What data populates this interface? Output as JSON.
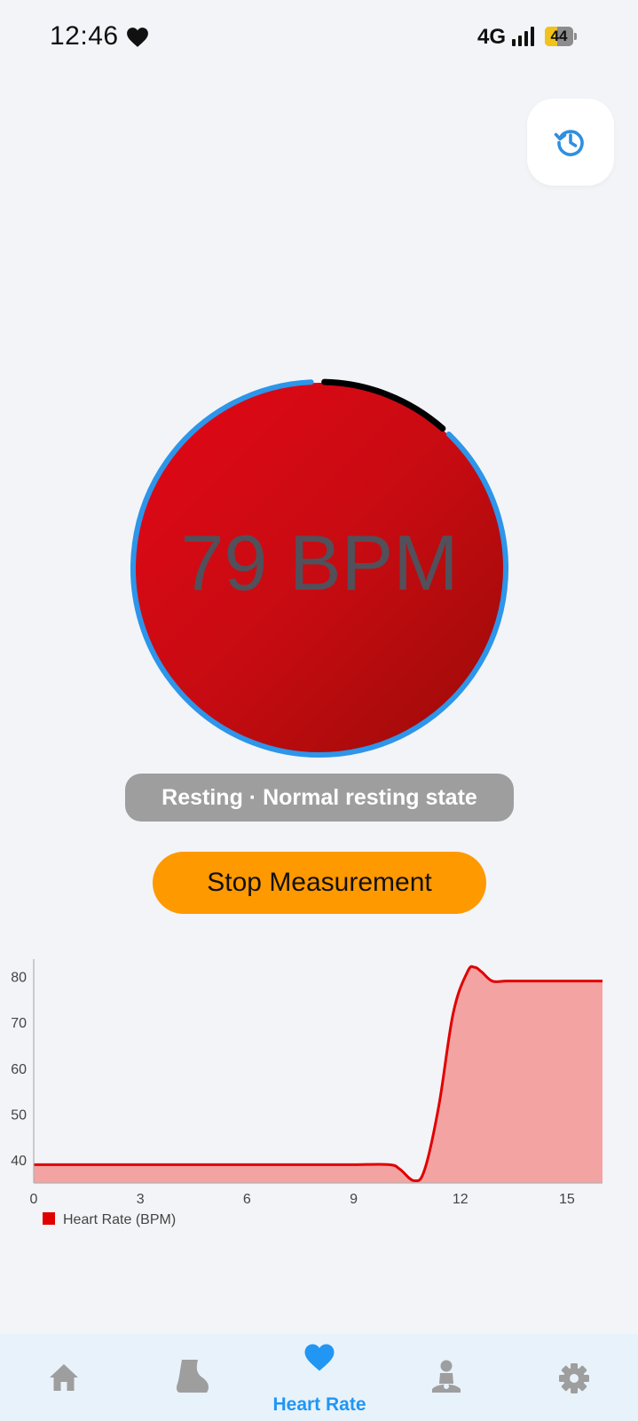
{
  "status_bar": {
    "time": "12:46",
    "network": "4G",
    "battery_level": "44",
    "battery_fraction": 0.44,
    "icons": [
      "heart-icon",
      "signal-icon",
      "battery-icon"
    ]
  },
  "history_button": {
    "icon": "history-icon",
    "color": "#2f8fe0"
  },
  "gauge": {
    "value_text": "79 BPM",
    "progress_fraction": 0.115,
    "colors": {
      "track": "#2d95ea",
      "progress": "#000000",
      "fill_start": "#e20716",
      "fill_end": "#9b0b07"
    }
  },
  "state": {
    "label": "Resting · Normal resting state"
  },
  "controls": {
    "stop_label": "Stop Measurement",
    "stop_color": "#ff9900"
  },
  "chart_data": {
    "type": "area",
    "x": [
      0,
      1,
      2,
      3,
      4,
      5,
      6,
      7,
      8,
      9,
      10,
      10.3,
      10.7,
      11,
      11.4,
      11.8,
      12.2,
      12.4,
      12.6,
      12.9,
      13.3,
      14,
      15,
      16
    ],
    "series": [
      {
        "name": "Heart Rate (BPM)",
        "values": [
          39,
          39,
          39,
          39,
          39,
          39,
          39,
          39,
          39,
          39,
          39,
          38,
          35.5,
          38,
          52,
          72,
          81,
          82,
          81,
          79,
          79,
          79,
          79,
          79
        ]
      }
    ],
    "x_ticks": [
      0,
      3,
      6,
      9,
      12,
      15
    ],
    "y_ticks": [
      40,
      50,
      60,
      70,
      80
    ],
    "xlim": [
      0,
      16
    ],
    "ylim": [
      35,
      83
    ],
    "grid": false,
    "legend_position": "bottom-left",
    "colors": {
      "line": "#e00000",
      "fill": "#f4a3a3",
      "legend_marker": "#e00000"
    }
  },
  "bottom_nav": {
    "items": [
      {
        "id": "home",
        "icon": "home-icon",
        "label": "",
        "active": false
      },
      {
        "id": "steps",
        "icon": "foot-icon",
        "label": "",
        "active": false
      },
      {
        "id": "heart-rate",
        "icon": "heart-icon",
        "label": "Heart Rate",
        "active": true
      },
      {
        "id": "meditation",
        "icon": "meditation-icon",
        "label": "",
        "active": false
      },
      {
        "id": "settings",
        "icon": "gear-icon",
        "label": "",
        "active": false
      }
    ],
    "active_color": "#2196f3",
    "inactive_color": "#9e9e9e"
  }
}
